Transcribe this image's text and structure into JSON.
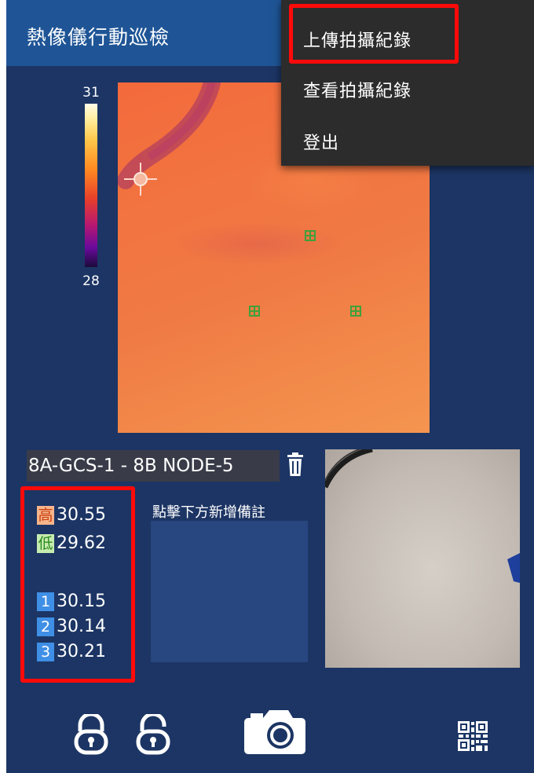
{
  "app": {
    "title": "熱像儀行動巡檢"
  },
  "menu": {
    "items": [
      {
        "label": "上傳拍攝紀錄",
        "highlighted": true
      },
      {
        "label": "查看拍攝紀錄"
      },
      {
        "label": "登出"
      }
    ]
  },
  "scale": {
    "max": "31",
    "min": "28"
  },
  "location": {
    "label": "8A-GCS-1 - 8B NODE-5"
  },
  "readings": {
    "high": {
      "tag": "高",
      "value": "30.55"
    },
    "low": {
      "tag": "低",
      "value": "29.62"
    },
    "points": [
      {
        "tag": "1",
        "value": "30.15"
      },
      {
        "tag": "2",
        "value": "30.14"
      },
      {
        "tag": "3",
        "value": "30.21"
      }
    ]
  },
  "remark": {
    "label": "點擊下方新增備註"
  },
  "toolbar": {
    "icons": [
      "lock-icon",
      "unlock-icon",
      "camera-icon",
      "qr-code-icon"
    ]
  },
  "colors": {
    "appbar": "#1f5596",
    "background": "#1c3564",
    "menu": "#2c2c2c",
    "highlight_border": "#ff0a0a",
    "point_tag": "#3f8fe6"
  }
}
